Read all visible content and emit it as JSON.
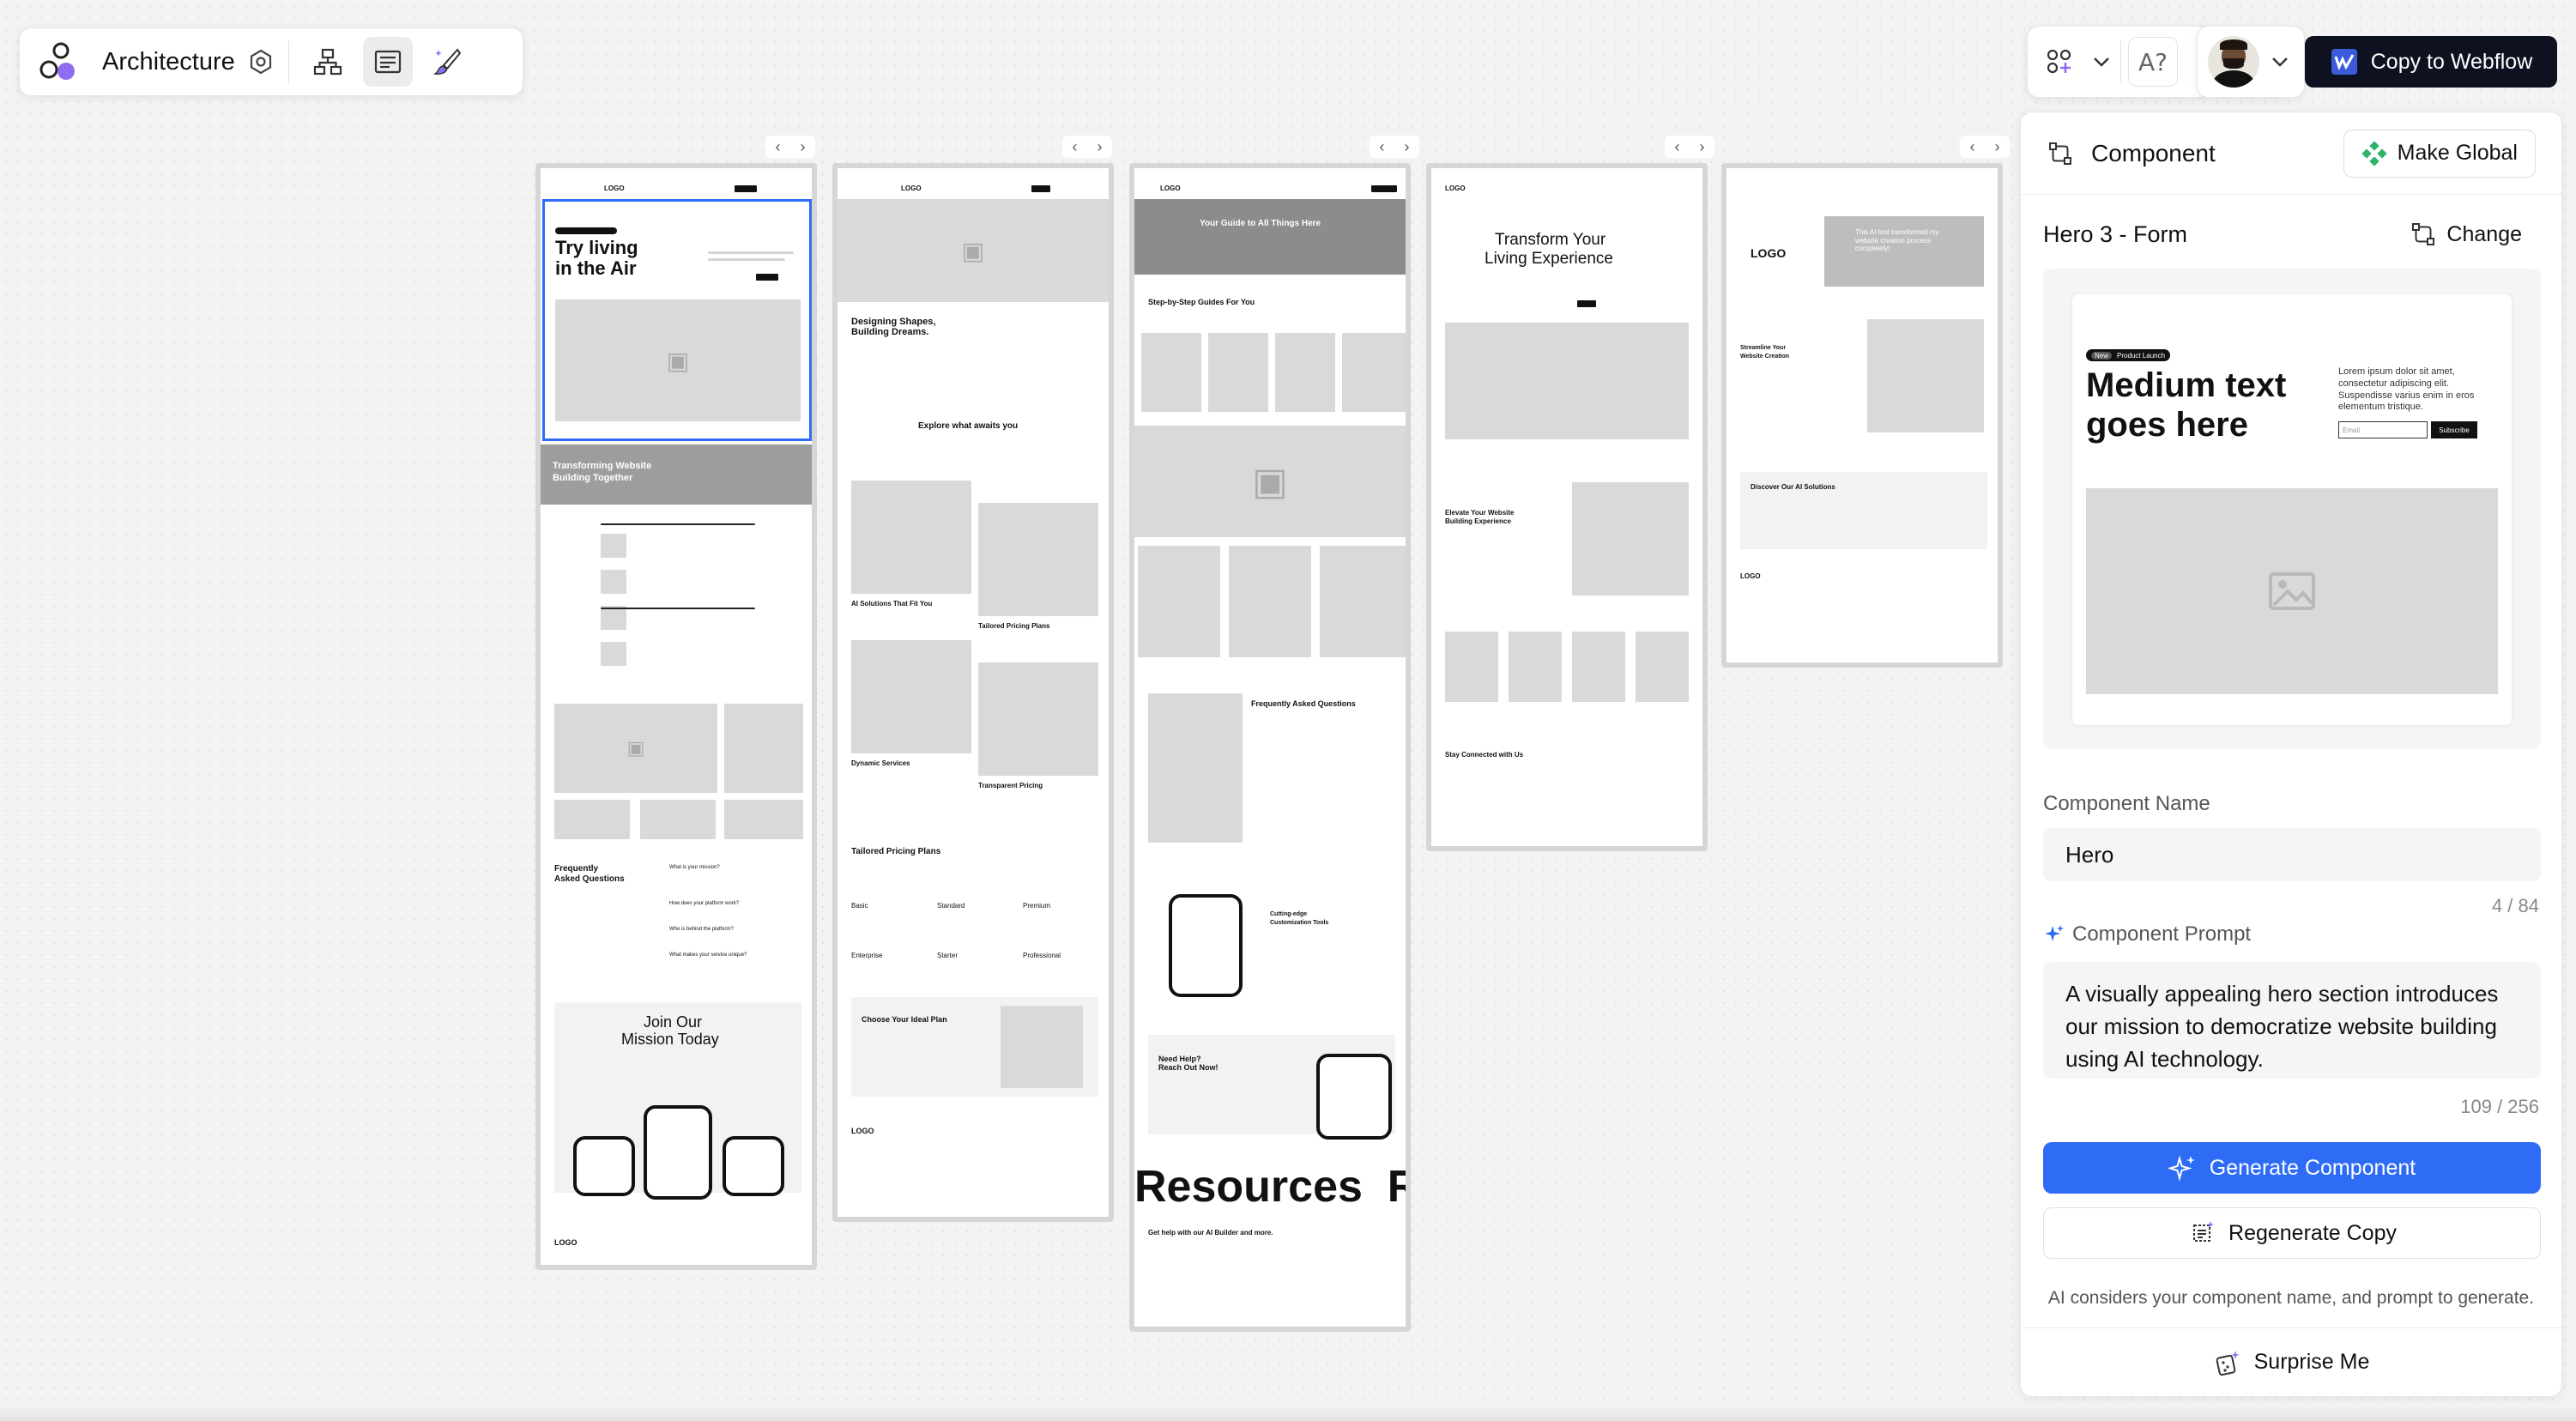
{
  "toolbar": {
    "project_title": "Architecture",
    "icons": [
      "settings-hex-icon",
      "sitemap-icon",
      "wireframe-icon",
      "style-guide-icon"
    ]
  },
  "topright": {
    "font_icon_text": "A?",
    "copy_label": "Copy to Webflow"
  },
  "canvas": {
    "page1": {
      "hero_title_1": "Try living",
      "hero_title_2": "in the Air",
      "band_title_1": "Transforming Website",
      "band_title_2": "Building Together",
      "faq_title_1": "Frequently",
      "faq_title_2": "Asked Questions",
      "faq_q1": "What is your mission?",
      "faq_q2": "How does your platform work?",
      "faq_q3": "Who is behind the platform?",
      "faq_q4": "What makes your service unique?",
      "cta_title_1": "Join Our",
      "cta_title_2": "Mission Today",
      "footer_logo": "LOGO",
      "nav_logo": "LOGO"
    },
    "page2": {
      "nav_logo": "LOGO",
      "hero_title_1": "Designing Shapes,",
      "hero_title_2": "Building Dreams.",
      "section_title": "Explore what awaits you",
      "card1": "AI Solutions That Fit You",
      "card2": "Tailored Pricing Plans",
      "card3": "Dynamic Services",
      "card4": "Transparent Pricing",
      "pricing_title": "Tailored Pricing Plans",
      "plans": [
        "Basic",
        "Standard",
        "Premium",
        "Enterprise",
        "Starter",
        "Professional"
      ],
      "choose_title": "Choose Your Ideal Plan",
      "footer_logo": "LOGO"
    },
    "page3": {
      "nav_logo": "LOGO",
      "hero_title": "Your Guide to All Things Here",
      "guide_title": "Step-by-Step Guides For You",
      "faq_title": "Frequently Asked Questions",
      "custom_title_1": "Cutting-edge",
      "custom_title_2": "Customization Tools",
      "help_title_1": "Need Help?",
      "help_title_2": "Reach Out Now!",
      "resources": "Resources  R",
      "resources_sub": "Get help with our AI Builder and more."
    },
    "page4": {
      "nav_logo": "LOGO",
      "hero_title_1": "Transform Your",
      "hero_title_2": "Living Experience",
      "elevate_title_1": "Elevate Your Website",
      "elevate_title_2": "Building Experience",
      "stay_title": "Stay Connected with Us"
    },
    "page5": {
      "logo": "LOGO",
      "quote": "This AI tool transformed my website creation process completely!",
      "stream_title_1": "Streamline Your",
      "stream_title_2": "Website Creation",
      "discover_title": "Discover Our AI Solutions",
      "footer_logo": "LOGO"
    }
  },
  "panel": {
    "header_label": "Component",
    "make_global_label": "Make Global",
    "component_variant": "Hero 3 - Form",
    "change_label": "Change",
    "preview": {
      "badge_new": "New",
      "badge_text": "Product Launch",
      "heading_1": "Medium text",
      "heading_2": "goes here",
      "body": "Lorem ipsum dolor sit amet, consectetur adipiscing elit. Suspendisse varius enim in eros elementum tristique.",
      "input_placeholder": "Email",
      "subscribe_label": "Subscribe"
    },
    "name_label": "Component Name",
    "name_value": "Hero",
    "name_counter": "4 / 84",
    "prompt_label": "Component Prompt",
    "prompt_value": "A visually appealing hero section introduces our mission to democratize website building using AI technology.",
    "prompt_counter": "109 / 256",
    "generate_label": "Generate Component",
    "regenerate_label": "Regenerate Copy",
    "hint": "AI considers your component name, and prompt to generate.",
    "surprise_label": "Surprise Me"
  },
  "colors": {
    "accent_blue": "#2f6cf6",
    "copy_button_bg": "#0e1220",
    "selection_outline": "#2f6cf6",
    "global_green": "#2fb36a"
  }
}
